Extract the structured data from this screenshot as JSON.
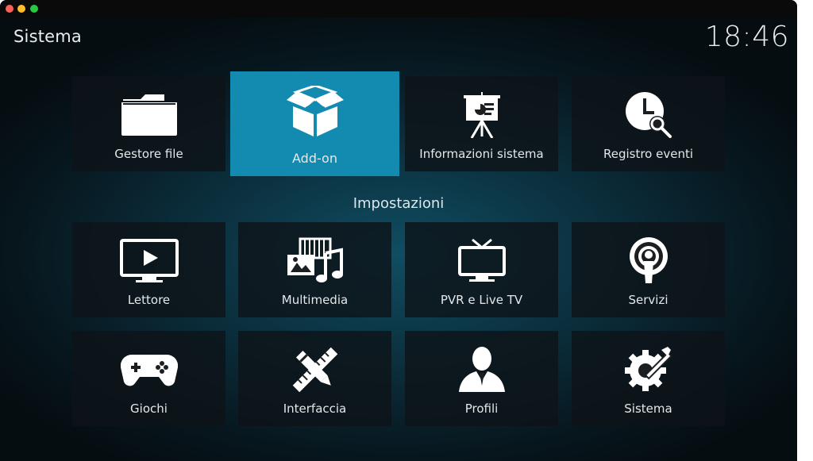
{
  "window": {
    "title": "Sistema",
    "clock": "18:46"
  },
  "section_title": "Impostazioni",
  "top_tiles": [
    {
      "label": "Gestore file",
      "icon": "folder-icon"
    },
    {
      "label": "Add-on",
      "icon": "open-box-icon",
      "focused": true
    },
    {
      "label": "Informazioni sistema",
      "icon": "presentation-easel-icon"
    },
    {
      "label": "Registro eventi",
      "icon": "clock-search-icon"
    }
  ],
  "settings_tiles": [
    {
      "label": "Lettore",
      "icon": "tv-play-icon"
    },
    {
      "label": "Multimedia",
      "icon": "media-film-music-icon"
    },
    {
      "label": "PVR e Live TV",
      "icon": "tv-antenna-icon"
    },
    {
      "label": "Servizi",
      "icon": "broadcast-podcast-icon"
    },
    {
      "label": "Giochi",
      "icon": "gamepad-icon"
    },
    {
      "label": "Interfaccia",
      "icon": "pencil-ruler-icon"
    },
    {
      "label": "Profili",
      "icon": "user-profile-icon"
    },
    {
      "label": "Sistema",
      "icon": "gear-wrench-icon"
    }
  ]
}
